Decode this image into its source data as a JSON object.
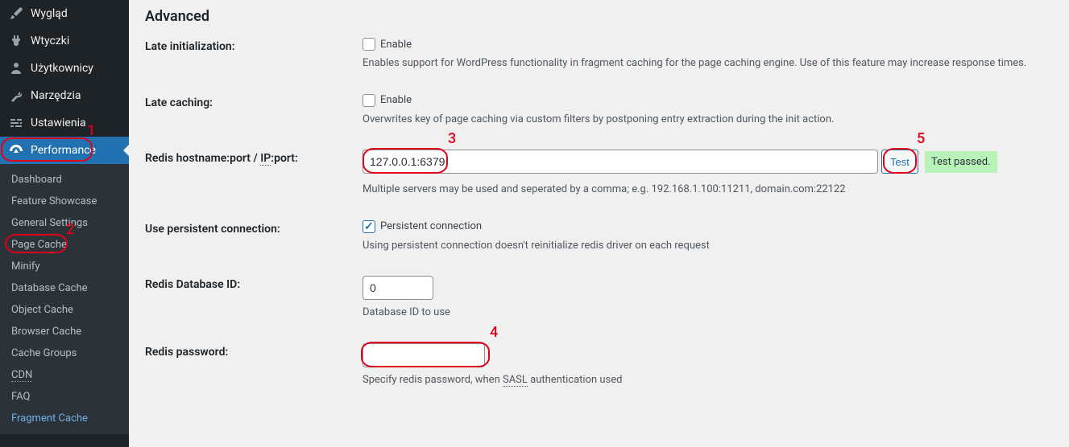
{
  "sidebar": {
    "items": {
      "wyglad": "Wygląd",
      "wtyczki": "Wtyczki",
      "uzytkownicy": "Użytkownicy",
      "narzedzia": "Narzędzia",
      "ustawienia": "Ustawienia",
      "performance": "Performance"
    },
    "sub": {
      "dashboard": "Dashboard",
      "feature_showcase": "Feature Showcase",
      "general_settings": "General Settings",
      "page_cache": "Page Cache",
      "minify": "Minify",
      "database_cache": "Database Cache",
      "object_cache": "Object Cache",
      "browser_cache": "Browser Cache",
      "cache_groups": "Cache Groups",
      "cdn": "CDN",
      "faq": "FAQ",
      "fragment_cache": "Fragment Cache"
    }
  },
  "page": {
    "title": "Advanced"
  },
  "late_init": {
    "label": "Late initialization:",
    "checkbox_label": "Enable",
    "checked": false,
    "help": "Enables support for WordPress functionality in fragment caching for the page caching engine. Use of this feature may increase response times."
  },
  "late_caching": {
    "label": "Late caching:",
    "checkbox_label": "Enable",
    "checked": false,
    "help": "Overwrites key of page caching via custom filters by postponing entry extraction during the init action."
  },
  "redis_host": {
    "label_pre": "Redis hostname:port / ",
    "label_dotted": "IP",
    "label_post": ":port:",
    "value": "127.0.0.1:6379",
    "test_label": "Test",
    "test_status": "Test passed.",
    "help": "Multiple servers may be used and seperated by a comma; e.g. 192.168.1.100:11211, domain.com:22122"
  },
  "persistent": {
    "label": "Use persistent connection:",
    "checkbox_label": "Persistent connection",
    "checked": true,
    "help": "Using persistent connection doesn't reinitialize redis driver on each request"
  },
  "redis_db": {
    "label": "Redis Database ID:",
    "value": "0",
    "help": "Database ID to use"
  },
  "redis_pw": {
    "label": "Redis password:",
    "value": "",
    "help_pre": "Specify redis password, when ",
    "help_dotted": "SASL",
    "help_post": " authentication used"
  },
  "annotations": {
    "n1": "1",
    "n2": "2",
    "n3": "3",
    "n4": "4",
    "n5": "5"
  }
}
